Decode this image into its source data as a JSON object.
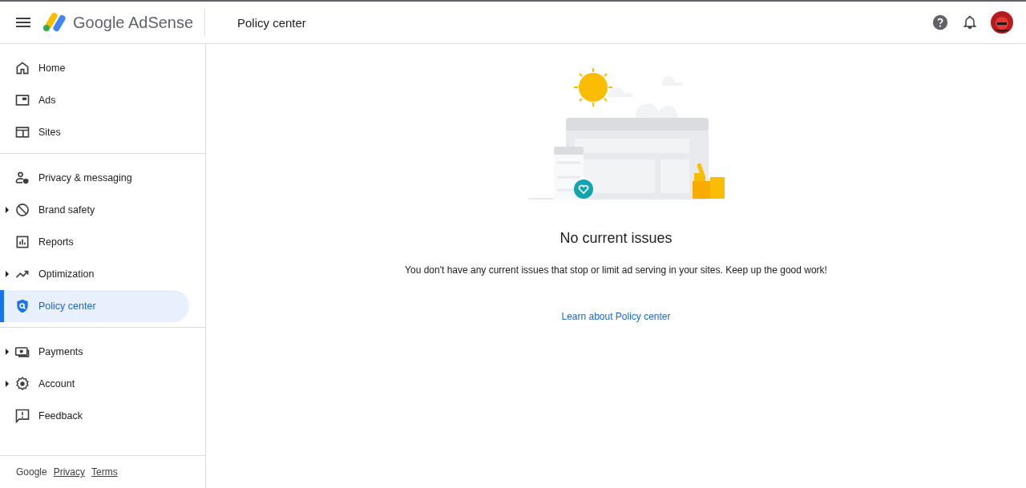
{
  "header": {
    "product": "Google AdSense",
    "page_title": "Policy center"
  },
  "sidebar": {
    "groups": [
      {
        "items": [
          {
            "label": "Home",
            "selected": false,
            "collapsible": false
          },
          {
            "label": "Ads",
            "selected": false,
            "collapsible": false
          },
          {
            "label": "Sites",
            "selected": false,
            "collapsible": false
          }
        ]
      },
      {
        "items": [
          {
            "label": "Privacy & messaging",
            "selected": false,
            "collapsible": false
          },
          {
            "label": "Brand safety",
            "selected": false,
            "collapsible": true
          },
          {
            "label": "Reports",
            "selected": false,
            "collapsible": false
          },
          {
            "label": "Optimization",
            "selected": false,
            "collapsible": true
          },
          {
            "label": "Policy center",
            "selected": true,
            "collapsible": false
          }
        ]
      },
      {
        "items": [
          {
            "label": "Payments",
            "selected": false,
            "collapsible": true
          },
          {
            "label": "Account",
            "selected": false,
            "collapsible": true
          },
          {
            "label": "Feedback",
            "selected": false,
            "collapsible": false
          }
        ]
      }
    ],
    "footer": {
      "brand": "Google",
      "links": [
        "Privacy",
        "Terms"
      ]
    }
  },
  "main": {
    "heading": "No current issues",
    "message": "You don't have any current issues that stop or limit ad serving in your sites. Keep up the good work!",
    "link": "Learn about Policy center"
  }
}
